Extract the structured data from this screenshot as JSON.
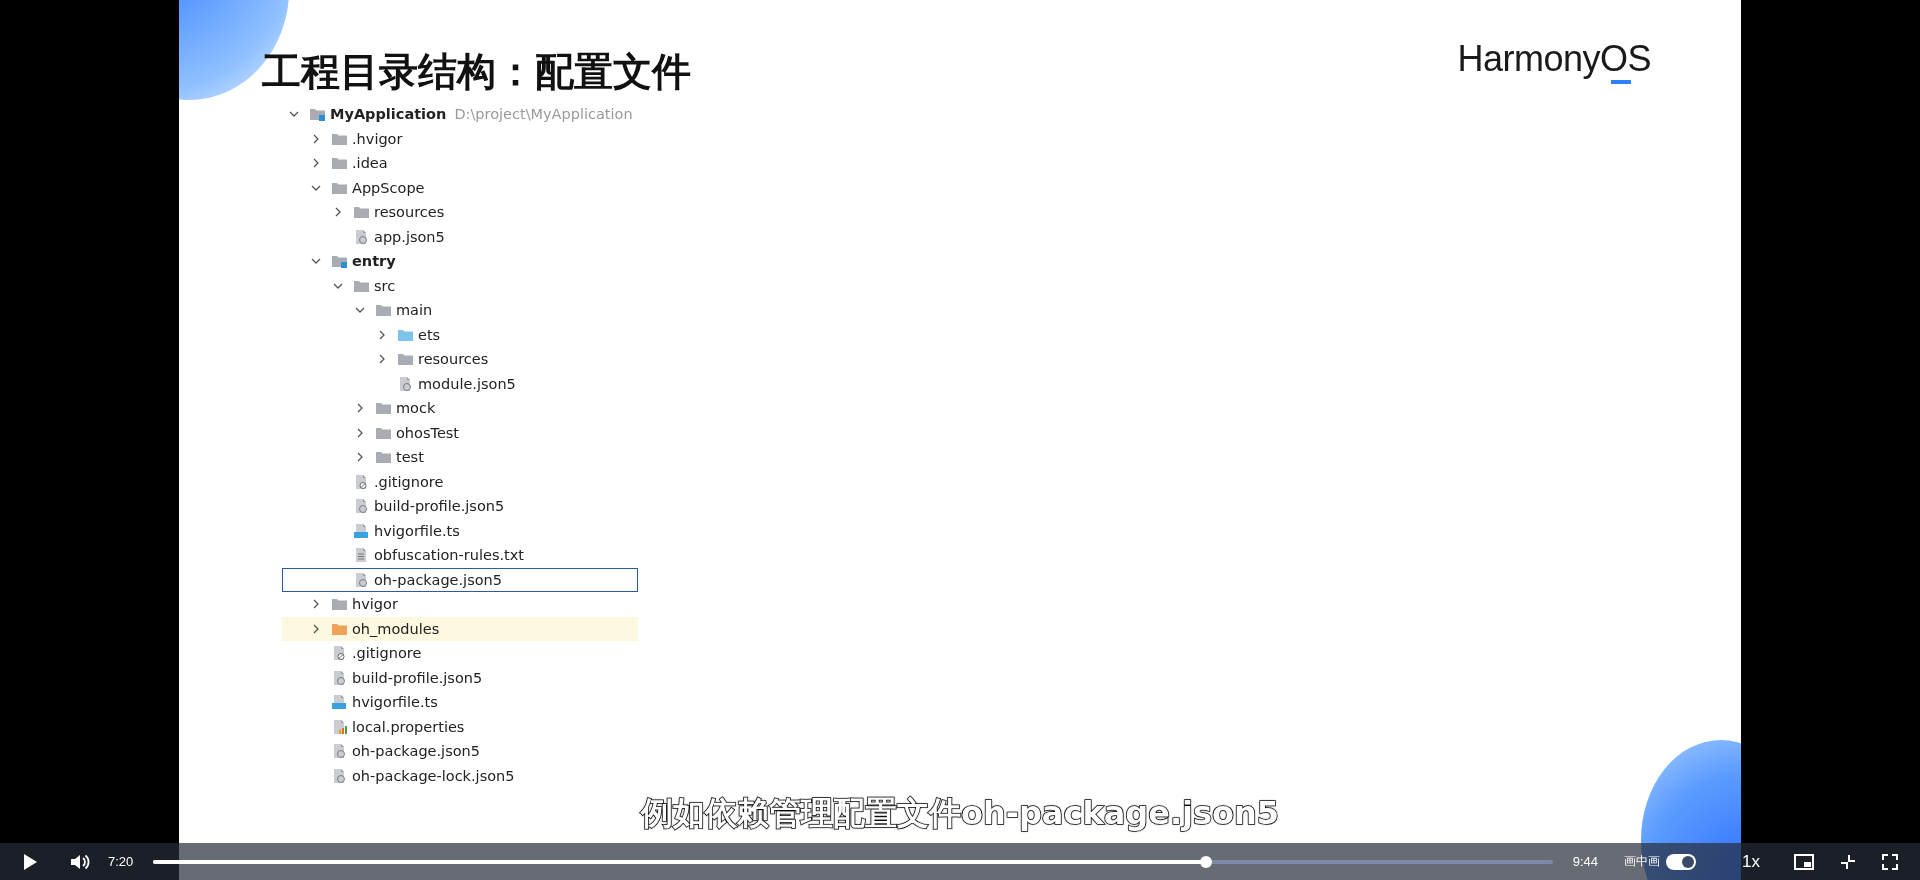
{
  "slide": {
    "title": "工程目录结构：配置文件",
    "logo": "HarmonyOS",
    "tree": [
      {
        "label": "MyApplication",
        "path": "D:\\project\\MyApplication",
        "kind": "module",
        "expanded": true,
        "selected": false,
        "children": [
          {
            "label": ".hvigor",
            "kind": "folder",
            "expanded": false,
            "selected": false
          },
          {
            "label": ".idea",
            "kind": "folder",
            "expanded": false,
            "selected": false
          },
          {
            "label": "AppScope",
            "kind": "folder",
            "expanded": true,
            "selected": false,
            "children": [
              {
                "label": "resources",
                "kind": "folder",
                "expanded": false,
                "selected": false
              },
              {
                "label": "app.json5",
                "kind": "json",
                "selected": false
              }
            ]
          },
          {
            "label": "entry",
            "kind": "module",
            "expanded": true,
            "selected": false,
            "children": [
              {
                "label": "src",
                "kind": "folder",
                "expanded": true,
                "selected": false,
                "children": [
                  {
                    "label": "main",
                    "kind": "folder",
                    "expanded": true,
                    "selected": false,
                    "children": [
                      {
                        "label": "ets",
                        "kind": "source-folder",
                        "expanded": false,
                        "selected": false
                      },
                      {
                        "label": "resources",
                        "kind": "folder",
                        "expanded": false,
                        "selected": false
                      },
                      {
                        "label": "module.json5",
                        "kind": "json",
                        "selected": false
                      }
                    ]
                  },
                  {
                    "label": "mock",
                    "kind": "folder",
                    "expanded": false,
                    "selected": false
                  },
                  {
                    "label": "ohosTest",
                    "kind": "folder",
                    "expanded": false,
                    "selected": false
                  },
                  {
                    "label": "test",
                    "kind": "folder",
                    "expanded": false,
                    "selected": false
                  }
                ]
              },
              {
                "label": ".gitignore",
                "kind": "gitignore",
                "selected": false
              },
              {
                "label": "build-profile.json5",
                "kind": "json",
                "selected": false
              },
              {
                "label": "hvigorfile.ts",
                "kind": "ts",
                "selected": false
              },
              {
                "label": "obfuscation-rules.txt",
                "kind": "txt",
                "selected": false
              },
              {
                "label": "oh-package.json5",
                "kind": "json",
                "selected": true
              }
            ]
          },
          {
            "label": "hvigor",
            "kind": "folder",
            "expanded": false,
            "selected": false
          },
          {
            "label": "oh_modules",
            "kind": "library-folder",
            "expanded": false,
            "selected": false
          },
          {
            "label": ".gitignore",
            "kind": "gitignore",
            "selected": false
          },
          {
            "label": "build-profile.json5",
            "kind": "json",
            "selected": false
          },
          {
            "label": "hvigorfile.ts",
            "kind": "ts",
            "selected": false
          },
          {
            "label": "local.properties",
            "kind": "properties",
            "selected": false
          },
          {
            "label": "oh-package.json5",
            "kind": "json",
            "selected": false
          },
          {
            "label": "oh-package-lock.json5",
            "kind": "json",
            "selected": false
          }
        ]
      }
    ]
  },
  "subtitle": "例如依赖管理配置文件oh-package.json5",
  "player": {
    "playing": false,
    "current_time": "7:20",
    "duration": "9:44",
    "progress": {
      "level": 0.752
    },
    "pip_label": "画中画",
    "pip_toggle": {
      "on": true
    },
    "speed": "1x"
  }
}
